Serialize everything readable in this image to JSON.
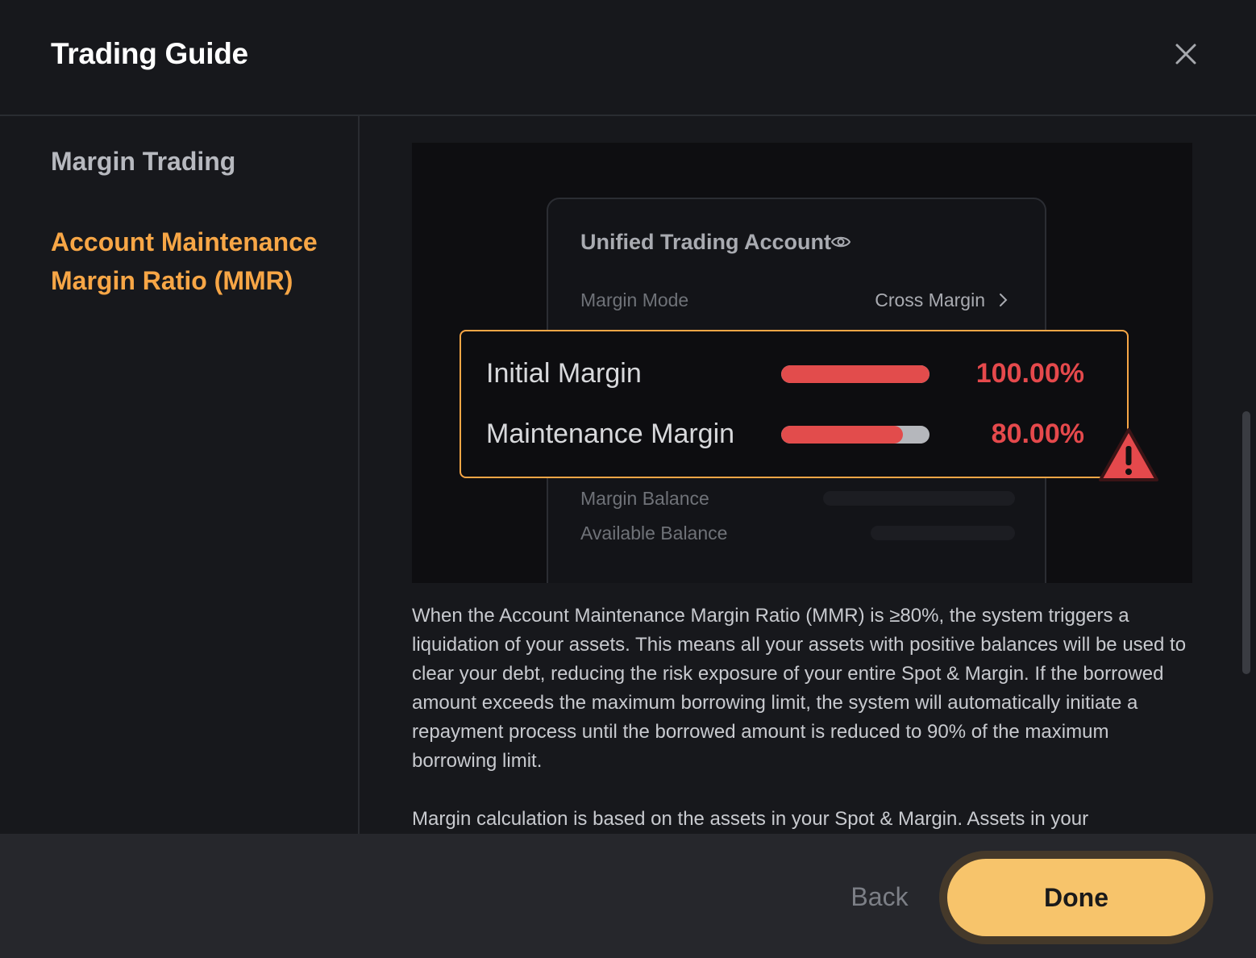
{
  "header": {
    "title": "Trading Guide"
  },
  "sidebar": {
    "heading": "Margin Trading",
    "items": [
      {
        "label": "Account Maintenance Margin Ratio (MMR)"
      }
    ]
  },
  "illustration": {
    "card_title": "Unified Trading Account",
    "margin_mode_label": "Margin Mode",
    "margin_mode_value": "Cross Margin",
    "initial_margin_label": "Initial Margin",
    "initial_margin_value": "100.00%",
    "initial_margin_fill": 1.0,
    "maintenance_margin_label": "Maintenance Margin",
    "maintenance_margin_value": "80.00%",
    "maintenance_margin_fill": 0.82,
    "margin_balance_label": "Margin Balance",
    "available_balance_label": "Available Balance",
    "icons": [
      "eye-icon",
      "chevron-right-icon",
      "warning-icon",
      "close-icon"
    ],
    "colors": {
      "accent": "#f7a646",
      "danger": "#e5494c",
      "done_button": "#f7c46b"
    }
  },
  "content": {
    "paragraph1": "When the Account Maintenance Margin Ratio (MMR) is ≥80%, the system triggers a liquidation of your assets. This means all your assets with positive balances will be used to clear your debt, reducing the risk exposure of your entire Spot & Margin. If the borrowed amount exceeds the maximum borrowing limit, the system will automatically initiate a repayment process until the borrowed amount is reduced to 90% of the maximum borrowing limit.",
    "paragraph2": "Margin calculation is based on the assets in your Spot & Margin. Assets in your"
  },
  "footer": {
    "back_label": "Back",
    "done_label": "Done"
  }
}
